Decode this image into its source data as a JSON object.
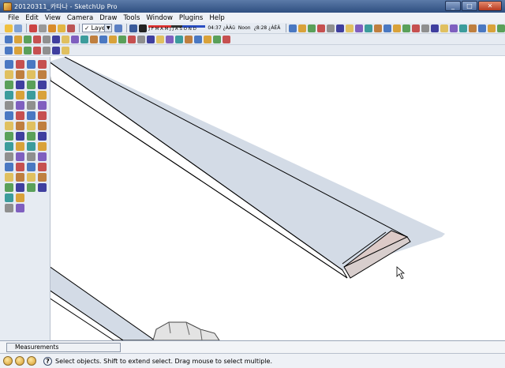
{
  "window": {
    "title": "20120311_카타나 - SketchUp Pro",
    "minimize": "_",
    "maximize": "□",
    "close": "✕"
  },
  "menu": [
    "File",
    "Edit",
    "View",
    "Camera",
    "Draw",
    "Tools",
    "Window",
    "Plugins",
    "Help"
  ],
  "layers": {
    "current": "Layer0"
  },
  "shadows": {
    "months": "J F M A M J J A S O N D",
    "time_label": "04:37 ¿ÀÀü",
    "noon": "Noon",
    "time_right": "¿8:28 ¿ÀÈÄ"
  },
  "measurements": {
    "label": "Measurements",
    "value": ""
  },
  "status": {
    "text": "Select objects. Shift to extend select. Drag mouse to select multiple."
  },
  "colors": {
    "face_blue": "#d3dbe6",
    "face_pink": "#dccac7",
    "edge": "#000000",
    "toolbar_bg": "#e6ebf2",
    "title_bg": "#2f4f80"
  },
  "toolbar_icons": {
    "row1": [
      "get-models",
      "share-model",
      "component",
      "layers",
      "material",
      "styles",
      "shadows",
      "fog",
      "xray",
      "back-edges",
      "wireframe",
      "hidden-line",
      "shaded",
      "shaded-texture",
      "monochrome",
      "iso",
      "top",
      "front",
      "right",
      "back",
      "left",
      "section-plane",
      "section-display",
      "section-cut"
    ],
    "row2": [
      "new",
      "open",
      "save",
      "cut",
      "copy",
      "paste",
      "erase",
      "undo",
      "redo",
      "print",
      "model-info",
      "sandbox-contours",
      "sandbox-scratch",
      "smoove",
      "stamp",
      "drape",
      "add-detail",
      "flip-edge",
      "solid-union",
      "solid-intersect",
      "solid-subtract",
      "solid-trim",
      "solid-split",
      "outer-shell"
    ],
    "row3": [
      "select-tool",
      "paint",
      "eraser",
      "follow",
      "dynamic-comp",
      "interact",
      "gears"
    ]
  }
}
